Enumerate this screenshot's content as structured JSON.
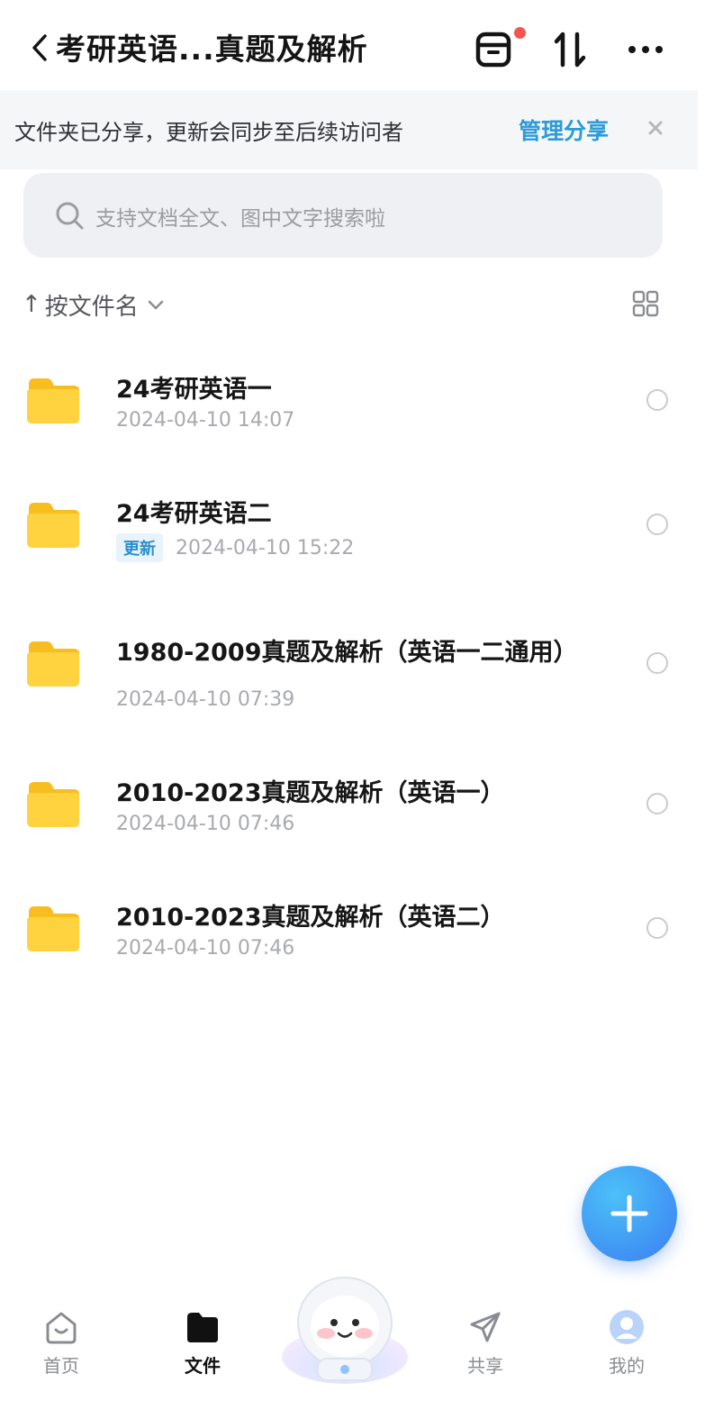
{
  "header": {
    "title": "考研英语...真题及解析",
    "back_icon": "chevron-left-icon",
    "inbox_icon": "inbox-icon",
    "sort_icon": "sort-arrows-icon",
    "more_icon": "more-dots-icon",
    "notification_dot_color": "#f4564f"
  },
  "banner": {
    "text": "文件夹已分享，更新会同步至后续访问者",
    "link": "管理分享",
    "link_color": "#2d9bd6",
    "close_icon": "close-icon"
  },
  "search": {
    "placeholder": "支持文档全文、图中文字搜索啦",
    "icon": "search-icon"
  },
  "sort": {
    "arrow": "↑",
    "label": "按文件名",
    "view_icon": "grid-view-icon"
  },
  "files": [
    {
      "name": "24考研英语一",
      "date": "2024-04-10 14:07",
      "badge": ""
    },
    {
      "name": "24考研英语二",
      "date": "2024-04-10 15:22",
      "badge": "更新"
    },
    {
      "name": "1980-2009真题及解析（英语一二通用）",
      "date": "2024-04-10 07:39",
      "badge": ""
    },
    {
      "name": "2010-2023真题及解析（英语一）",
      "date": "2024-04-10 07:46",
      "badge": ""
    },
    {
      "name": "2010-2023真题及解析（英语二）",
      "date": "2024-04-10 07:46",
      "badge": ""
    }
  ],
  "fab": {
    "icon": "plus-icon"
  },
  "nav": {
    "items": [
      {
        "label": "首页",
        "icon": "home-icon",
        "active": false
      },
      {
        "label": "文件",
        "icon": "folder-icon",
        "active": true
      },
      {
        "label": "共享",
        "icon": "send-icon",
        "active": false
      },
      {
        "label": "我的",
        "icon": "avatar-icon",
        "active": false
      }
    ],
    "assistant_icon": "mascot-assistant-icon"
  },
  "colors": {
    "accent": "#2d9bd6",
    "folder": "#ffd23f",
    "fab_start": "#4cc0f8",
    "fab_end": "#3a7ef2"
  }
}
